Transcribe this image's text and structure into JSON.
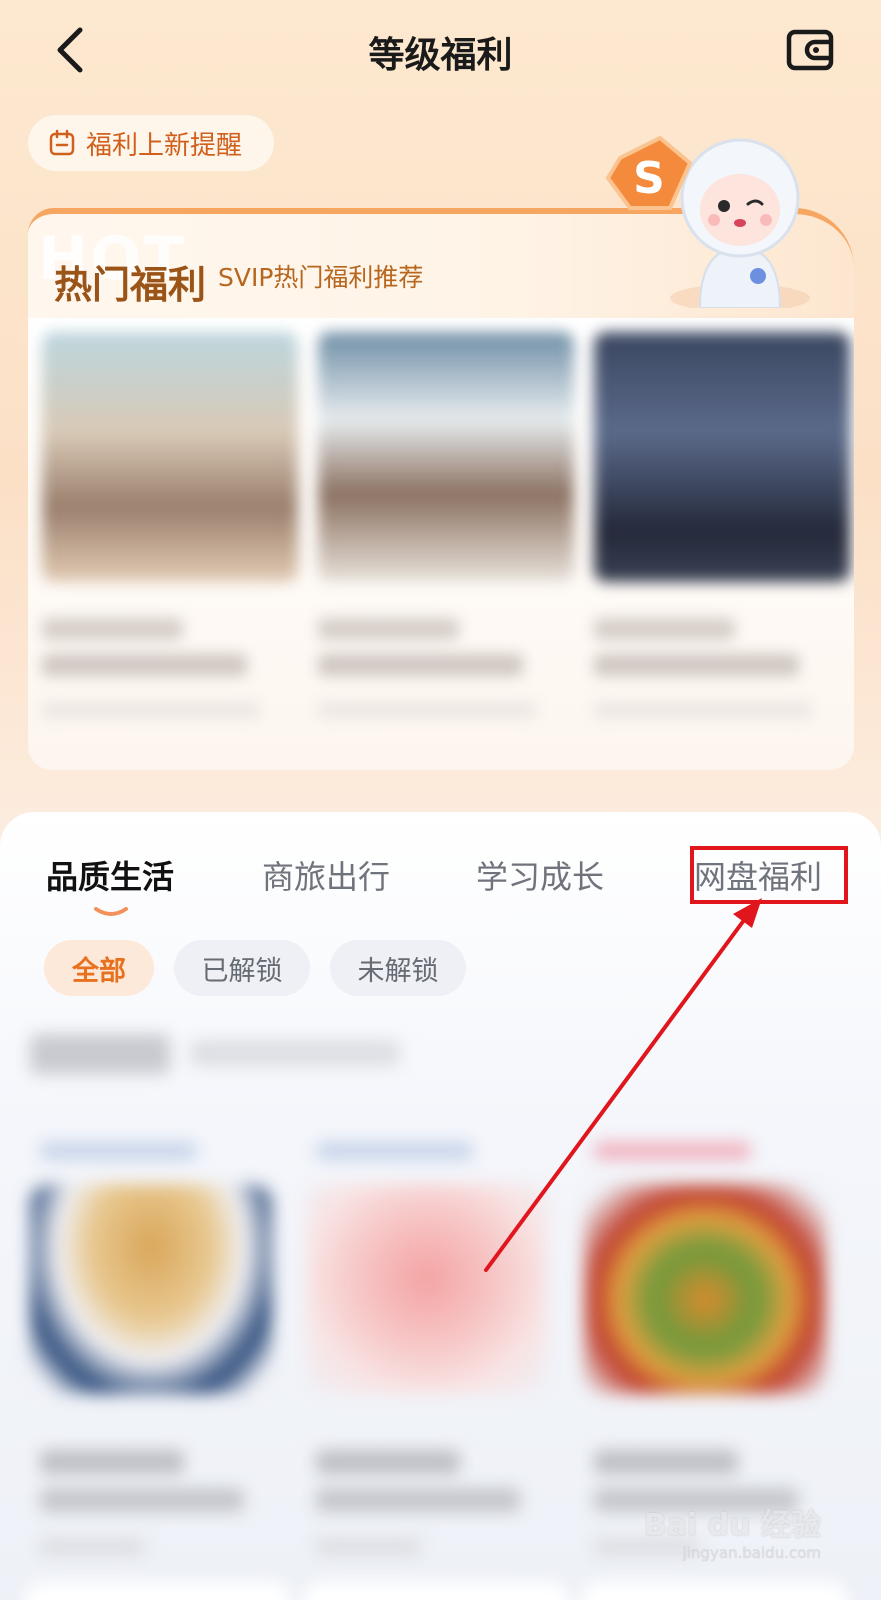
{
  "header": {
    "title": "等级福利"
  },
  "reminder": {
    "label": "福利上新提醒"
  },
  "hot": {
    "ghost_text": "HOT",
    "title": "热门福利",
    "subtitle": "SVIP热门福利推荐",
    "badge_letter": "S"
  },
  "tabs": [
    {
      "label": "品质生活",
      "active": true
    },
    {
      "label": "商旅出行",
      "active": false
    },
    {
      "label": "学习成长",
      "active": false
    },
    {
      "label": "网盘福利",
      "active": false,
      "highlighted": true
    }
  ],
  "filters": [
    {
      "label": "全部",
      "active": true
    },
    {
      "label": "已解锁",
      "active": false
    },
    {
      "label": "未解锁",
      "active": false
    }
  ],
  "colors": {
    "accent": "#e8711f",
    "annotation_red": "#e0161c",
    "hot_title": "#9a5418"
  },
  "watermark": {
    "brand": "Bai du 经验",
    "url": "jingyan.baidu.com"
  }
}
